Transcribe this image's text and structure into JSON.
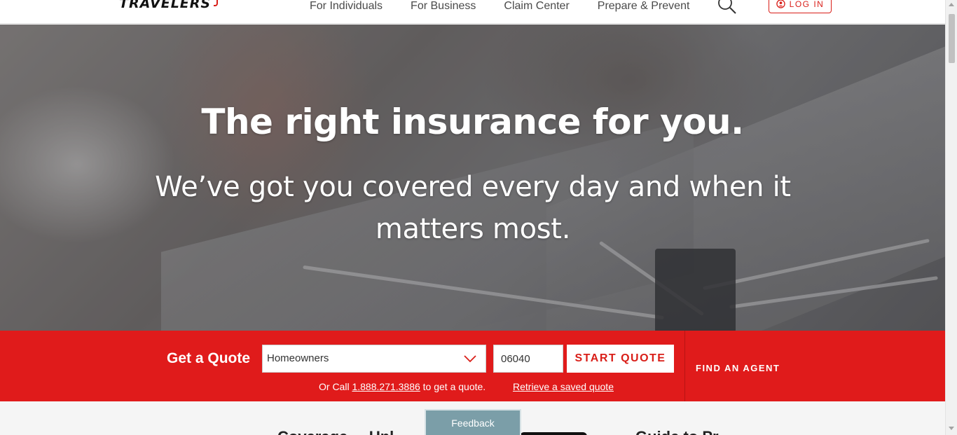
{
  "header": {
    "logo": "TRAVELERS",
    "nav": [
      "For Individuals",
      "For Business",
      "Claim Center",
      "Prepare & Prevent"
    ],
    "login_label": "LOG IN"
  },
  "hero": {
    "title": "The right insurance for you.",
    "subtitle": "We’ve got you covered every day and when it matters most."
  },
  "quote": {
    "label": "Get a Quote",
    "product_selected": "Homeowners",
    "zip_value": "06040",
    "start_label": "START QUOTE",
    "call_prefix": "Or Call ",
    "phone": "1.888.271.3886",
    "call_suffix": " to get a quote.",
    "retrieve_label": "Retrieve a saved quote",
    "find_agent_label": "FIND AN AGENT"
  },
  "below": {
    "left_text": "Coverage ... Unl",
    "right_text": "Guide to Pr"
  },
  "feedback_label": "Feedback",
  "colors": {
    "brand_red": "#e01b1b",
    "accent_red": "#d91e18",
    "feedback": "#7b9ea8"
  }
}
